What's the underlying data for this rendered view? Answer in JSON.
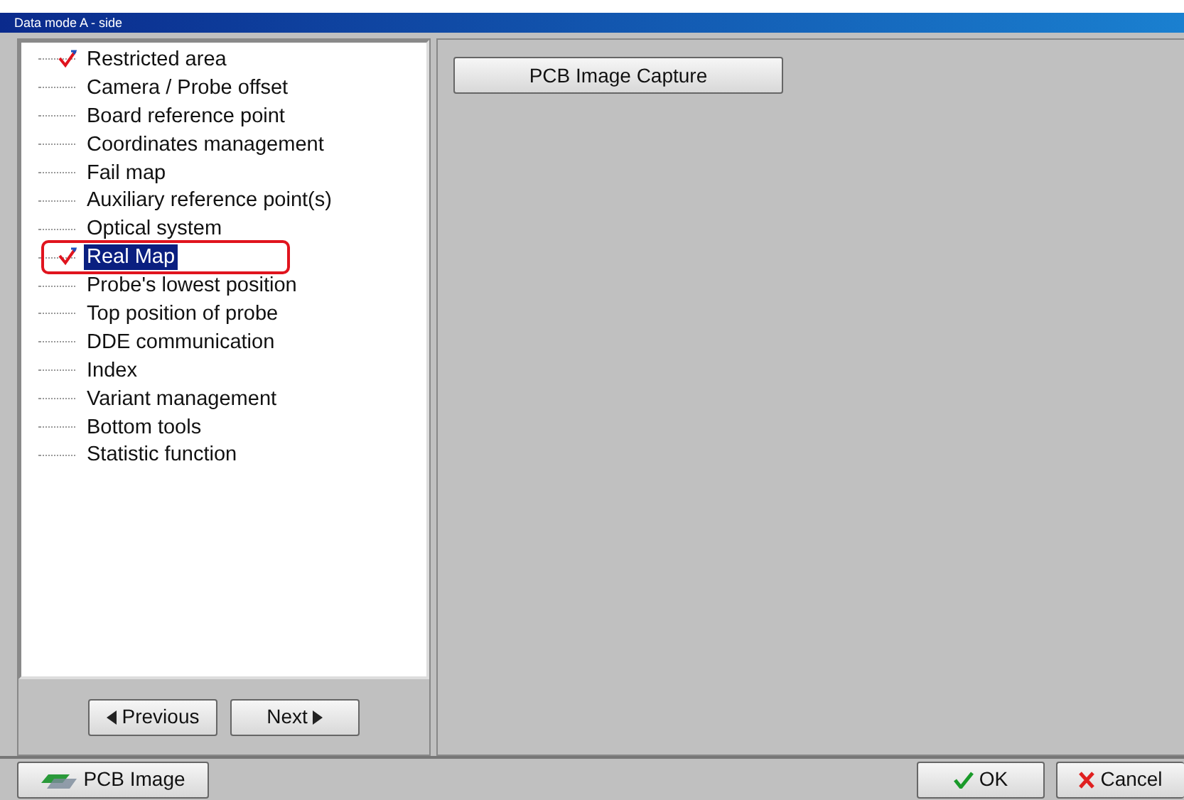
{
  "window": {
    "title": "Data mode  A - side"
  },
  "tree": {
    "items": [
      {
        "label": "Restricted area",
        "checked": true,
        "selected": false,
        "outlined": false
      },
      {
        "label": "Camera / Probe offset",
        "checked": false,
        "selected": false,
        "outlined": false
      },
      {
        "label": "Board reference point",
        "checked": false,
        "selected": false,
        "outlined": false
      },
      {
        "label": "Coordinates management",
        "checked": false,
        "selected": false,
        "outlined": false
      },
      {
        "label": "Fail map",
        "checked": false,
        "selected": false,
        "outlined": false
      },
      {
        "label": "Auxiliary reference point(s)",
        "checked": false,
        "selected": false,
        "outlined": false
      },
      {
        "label": "Optical system",
        "checked": false,
        "selected": false,
        "outlined": false
      },
      {
        "label": "Real Map",
        "checked": true,
        "selected": true,
        "outlined": true
      },
      {
        "label": "Probe's lowest position",
        "checked": false,
        "selected": false,
        "outlined": false
      },
      {
        "label": "Top position of probe",
        "checked": false,
        "selected": false,
        "outlined": false
      },
      {
        "label": "DDE communication",
        "checked": false,
        "selected": false,
        "outlined": false
      },
      {
        "label": "Index",
        "checked": false,
        "selected": false,
        "outlined": false
      },
      {
        "label": "Variant management",
        "checked": false,
        "selected": false,
        "outlined": false
      },
      {
        "label": "Bottom tools",
        "checked": false,
        "selected": false,
        "outlined": false
      },
      {
        "label": "Statistic function",
        "checked": false,
        "selected": false,
        "outlined": false
      }
    ]
  },
  "nav_buttons": [
    {
      "label": "Previous",
      "kind": "prev"
    },
    {
      "label": "Next",
      "kind": "next"
    }
  ],
  "content": {
    "capture_button": "PCB Image Capture"
  },
  "footer": {
    "left_button": "PCB Image",
    "ok_button": "OK",
    "cancel_button": "Cancel"
  }
}
